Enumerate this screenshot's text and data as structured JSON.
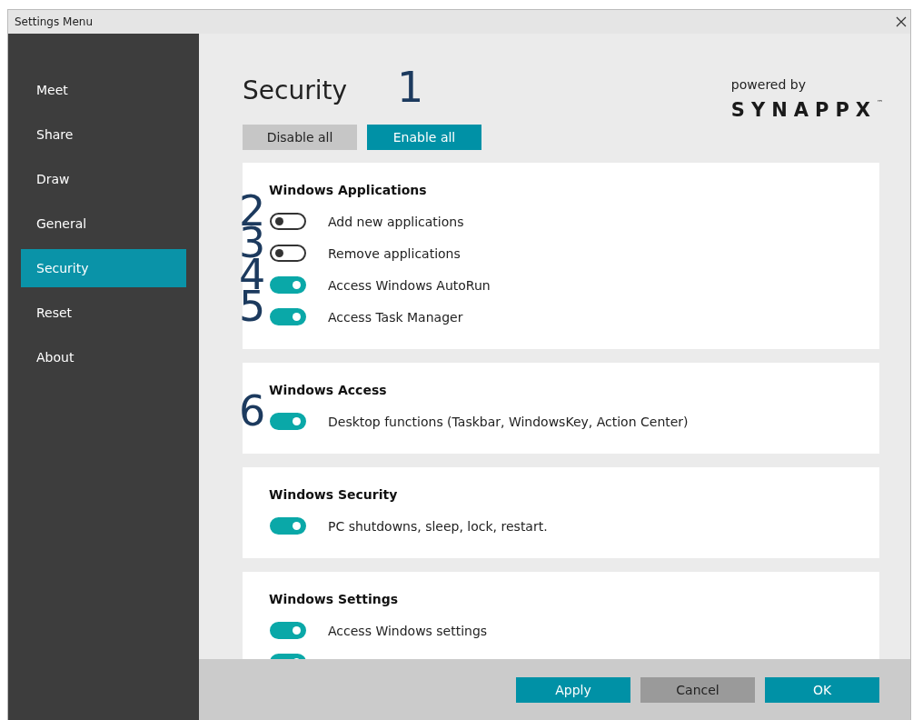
{
  "window": {
    "title": "Settings Menu"
  },
  "sidebar": {
    "items": [
      {
        "label": "Meet",
        "selected": false
      },
      {
        "label": "Share",
        "selected": false
      },
      {
        "label": "Draw",
        "selected": false
      },
      {
        "label": "General",
        "selected": false
      },
      {
        "label": "Security",
        "selected": true
      },
      {
        "label": "Reset",
        "selected": false
      },
      {
        "label": "About",
        "selected": false
      }
    ]
  },
  "page": {
    "title": "Security",
    "callout": "1",
    "buttons": [
      {
        "label": "Disable all",
        "kind": "secondary"
      },
      {
        "label": "Enable all",
        "kind": "primary"
      }
    ]
  },
  "branding": {
    "caption": "powered by",
    "logo": "SYNAPPX",
    "trademark": "™"
  },
  "sections": [
    {
      "title": "Windows Applications",
      "options": [
        {
          "label": "Add new applications",
          "on": false,
          "callout": "2"
        },
        {
          "label": "Remove applications",
          "on": false,
          "callout": "3"
        },
        {
          "label": "Access Windows AutoRun",
          "on": true,
          "callout": "4"
        },
        {
          "label": "Access Task Manager",
          "on": true,
          "callout": "5"
        }
      ]
    },
    {
      "title": "Windows Access",
      "options": [
        {
          "label": "Desktop functions (Taskbar, WindowsKey, Action Center)",
          "on": true,
          "callout": "6"
        }
      ]
    },
    {
      "title": "Windows Security",
      "options": [
        {
          "label": "PC shutdowns, sleep, lock, restart.",
          "on": true
        }
      ]
    },
    {
      "title": "Windows Settings",
      "options": [
        {
          "label": "Access Windows settings",
          "on": true
        },
        {
          "on": true
        }
      ]
    }
  ],
  "footer": {
    "buttons": [
      {
        "label": "Apply",
        "kind": "primary"
      },
      {
        "label": "Cancel",
        "kind": "secondary"
      },
      {
        "label": "OK",
        "kind": "primary"
      }
    ]
  }
}
